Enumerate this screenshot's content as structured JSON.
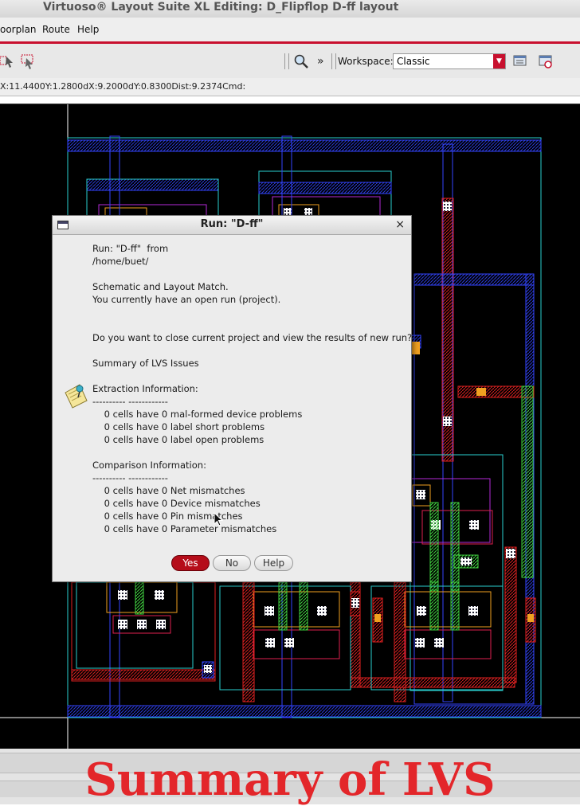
{
  "window": {
    "title": "Virtuoso® Layout Suite XL Editing: D_Flipflop D-ff layout"
  },
  "menubar": {
    "items": [
      {
        "label": "oorplan"
      },
      {
        "label": "Route"
      },
      {
        "label": "Help"
      }
    ]
  },
  "toolbar": {
    "overflow_label": "»",
    "workspace_label": "Workspace:",
    "workspace_value": "Classic"
  },
  "status": {
    "text": "X:11.4400Y:1.2800dX:9.2000dY:0.8300Dist:9.2374Cmd:"
  },
  "dialog": {
    "title": "Run: \"D-ff\"",
    "close_glyph": "×",
    "lines": [
      "Run: \"D-ff\"  from",
      "/home/buet/",
      "",
      "Schematic and Layout Match.",
      "You currently have an open run (project).",
      "",
      "",
      "Do you want to close current project and view the results of new run?",
      "",
      "Summary of LVS Issues",
      "",
      "Extraction Information:",
      "---------- ------------",
      "    0 cells have 0 mal-formed device problems",
      "    0 cells have 0 label short problems",
      "    0 cells have 0 label open problems",
      "",
      "Comparison Information:",
      "---------- ------------",
      "    0 cells have 0 Net mismatches",
      "    0 cells have 0 Device mismatches",
      "    0 cells have 0 Pin mismatches",
      "    0 cells have 0 Parameter mismatches"
    ],
    "buttons": {
      "yes": "Yes",
      "no": "No",
      "help": "Help"
    }
  },
  "caption": "Summary of LVS",
  "colors": {
    "accent": "#c8102e",
    "caption": "#e3262a",
    "canvas": "#000000"
  }
}
